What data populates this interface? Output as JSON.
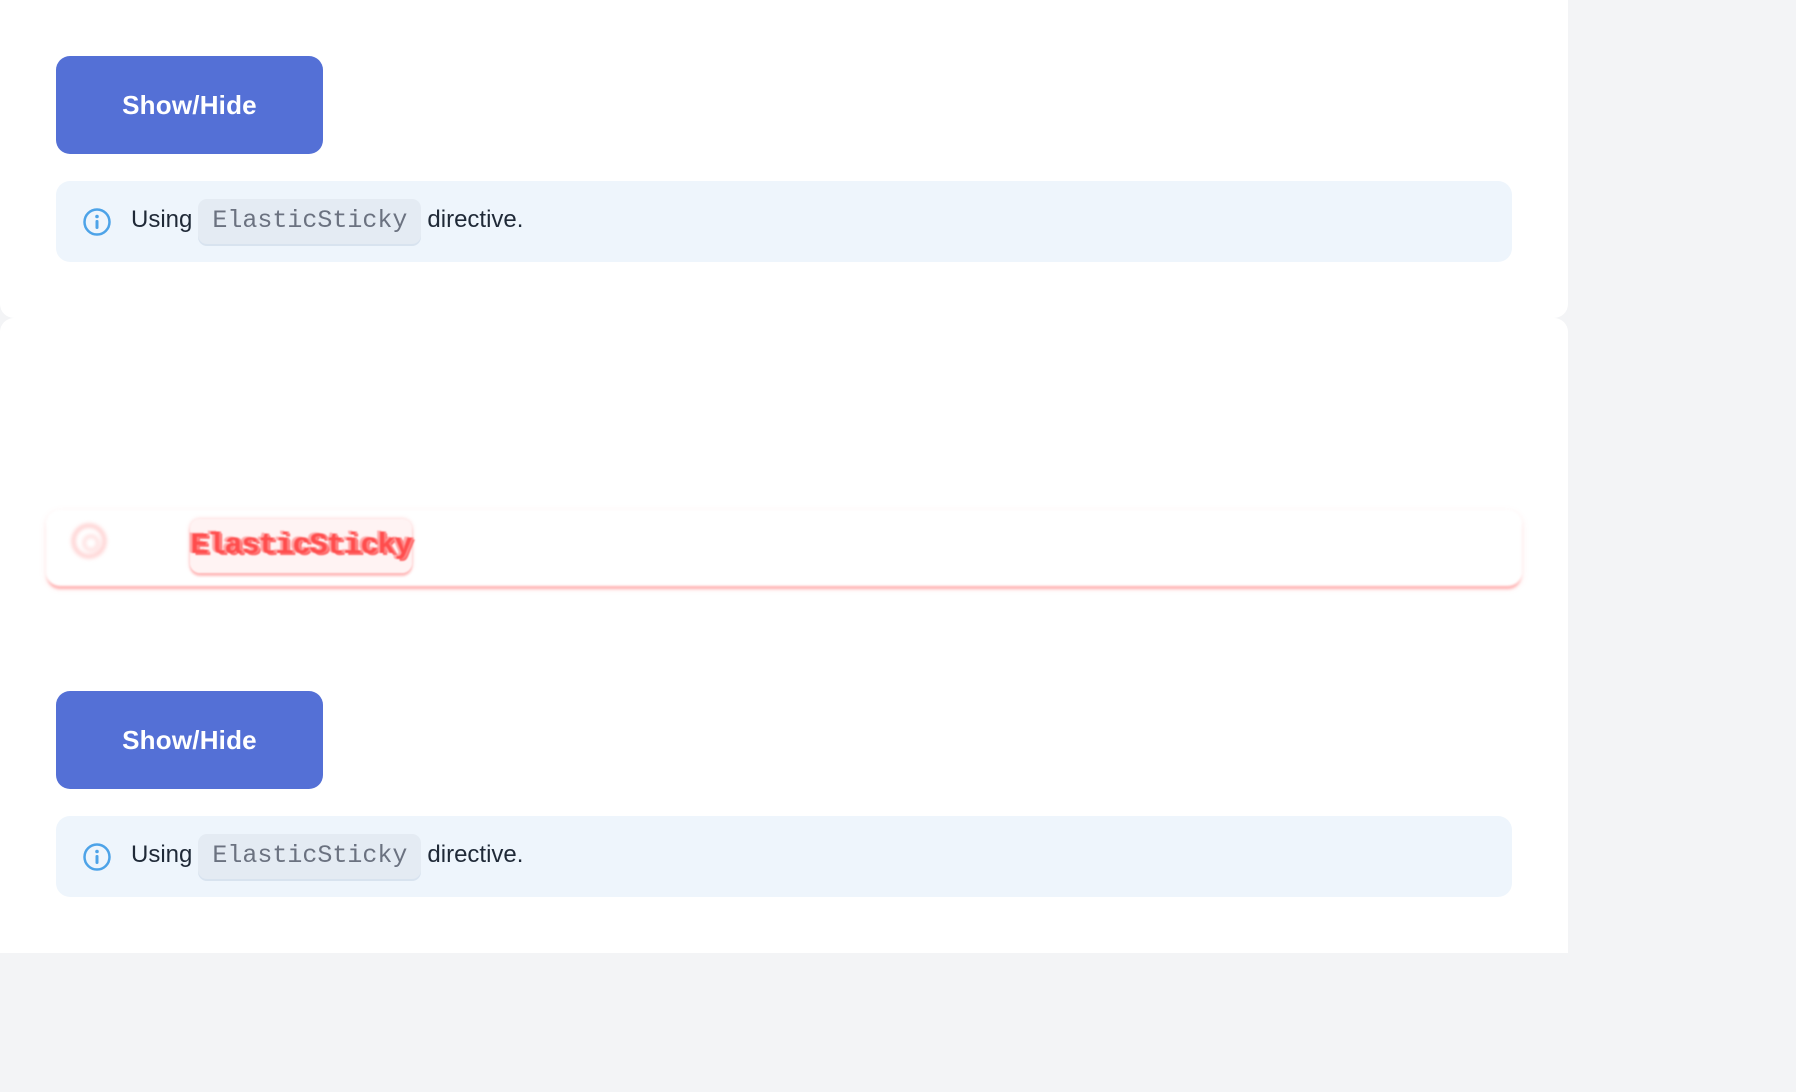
{
  "top": {
    "button_label": "Show/Hide",
    "notice": {
      "prefix": "Using",
      "code": "ElasticSticky",
      "suffix": "directive."
    }
  },
  "ghost": {
    "code": "ElasticSticky"
  },
  "bottom": {
    "button_label": "Show/Hide",
    "notice": {
      "prefix": "Using",
      "code": "ElasticSticky",
      "suffix": "directive."
    }
  },
  "colors": {
    "button": "#5470d6",
    "notice_bg": "#eef5fc",
    "info_icon": "#4da3e8",
    "ghost_accent": "#ff3b3b"
  },
  "icons": [
    "info-icon"
  ]
}
